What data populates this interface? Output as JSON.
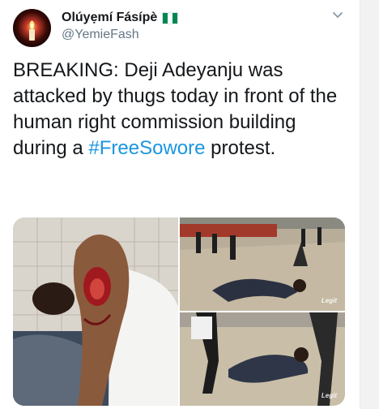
{
  "tweet": {
    "display_name": "Olúyẹmí Fásípè",
    "handle": "@YemieFash",
    "text_before": "BREAKING: Deji Adeyanju was attacked by thugs today in front of the human right commission building during a ",
    "hashtag": "#FreeSowore",
    "text_after": " protest.",
    "flag_icon": "nigeria-flag-icon",
    "menu_icon": "chevron-down-icon"
  },
  "media": {
    "watermark_top": "Legit",
    "watermark_bottom": "Legit"
  },
  "colors": {
    "hashtag": "#1b95e0",
    "flag_green": "#008751",
    "name": "#14171a",
    "handle": "#657786"
  }
}
